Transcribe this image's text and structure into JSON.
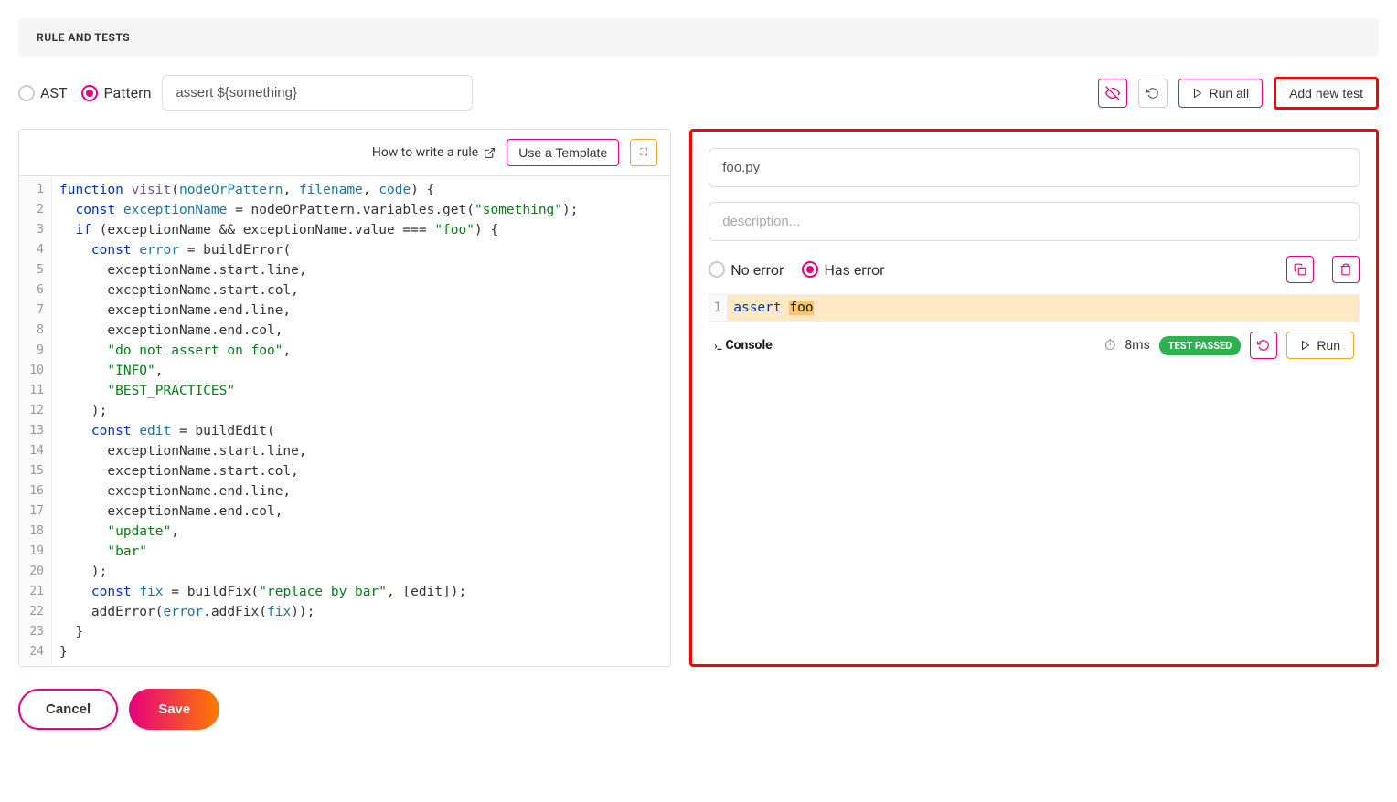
{
  "header": {
    "title": "RULE AND TESTS"
  },
  "mode": {
    "ast_label": "AST",
    "pattern_label": "Pattern",
    "pattern_value": "assert ${something}"
  },
  "toolbar": {
    "run_all_label": "Run all",
    "add_test_label": "Add new test"
  },
  "editor_toolbar": {
    "howto_label": "How to write a rule",
    "template_label": "Use a Template"
  },
  "code": {
    "lines": [
      [
        {
          "t": "kw",
          "s": "function"
        },
        {
          "t": "op",
          "s": " "
        },
        {
          "t": "fn",
          "s": "visit"
        },
        {
          "t": "op",
          "s": "("
        },
        {
          "t": "var",
          "s": "nodeOrPattern"
        },
        {
          "t": "op",
          "s": ", "
        },
        {
          "t": "var",
          "s": "filename"
        },
        {
          "t": "op",
          "s": ", "
        },
        {
          "t": "var",
          "s": "code"
        },
        {
          "t": "op",
          "s": ") {"
        }
      ],
      [
        {
          "t": "op",
          "s": "  "
        },
        {
          "t": "kw",
          "s": "const"
        },
        {
          "t": "op",
          "s": " "
        },
        {
          "t": "var",
          "s": "exceptionName"
        },
        {
          "t": "op",
          "s": " = nodeOrPattern.variables.get("
        },
        {
          "t": "str",
          "s": "\"something\""
        },
        {
          "t": "op",
          "s": ");"
        }
      ],
      [
        {
          "t": "op",
          "s": "  "
        },
        {
          "t": "kw",
          "s": "if"
        },
        {
          "t": "op",
          "s": " (exceptionName && exceptionName.value === "
        },
        {
          "t": "str",
          "s": "\"foo\""
        },
        {
          "t": "op",
          "s": ") {"
        }
      ],
      [
        {
          "t": "op",
          "s": "    "
        },
        {
          "t": "kw",
          "s": "const"
        },
        {
          "t": "op",
          "s": " "
        },
        {
          "t": "var",
          "s": "error"
        },
        {
          "t": "op",
          "s": " = buildError("
        }
      ],
      [
        {
          "t": "op",
          "s": "      exceptionName.start.line,"
        }
      ],
      [
        {
          "t": "op",
          "s": "      exceptionName.start.col,"
        }
      ],
      [
        {
          "t": "op",
          "s": "      exceptionName.end.line,"
        }
      ],
      [
        {
          "t": "op",
          "s": "      exceptionName.end.col,"
        }
      ],
      [
        {
          "t": "op",
          "s": "      "
        },
        {
          "t": "str",
          "s": "\"do not assert on foo\""
        },
        {
          "t": "op",
          "s": ","
        }
      ],
      [
        {
          "t": "op",
          "s": "      "
        },
        {
          "t": "str",
          "s": "\"INFO\""
        },
        {
          "t": "op",
          "s": ","
        }
      ],
      [
        {
          "t": "op",
          "s": "      "
        },
        {
          "t": "str",
          "s": "\"BEST_PRACTICES\""
        }
      ],
      [
        {
          "t": "op",
          "s": "    );"
        }
      ],
      [
        {
          "t": "op",
          "s": "    "
        },
        {
          "t": "kw",
          "s": "const"
        },
        {
          "t": "op",
          "s": " "
        },
        {
          "t": "var",
          "s": "edit"
        },
        {
          "t": "op",
          "s": " = buildEdit("
        }
      ],
      [
        {
          "t": "op",
          "s": "      exceptionName.start.line,"
        }
      ],
      [
        {
          "t": "op",
          "s": "      exceptionName.start.col,"
        }
      ],
      [
        {
          "t": "op",
          "s": "      exceptionName.end.line,"
        }
      ],
      [
        {
          "t": "op",
          "s": "      exceptionName.end.col,"
        }
      ],
      [
        {
          "t": "op",
          "s": "      "
        },
        {
          "t": "str",
          "s": "\"update\""
        },
        {
          "t": "op",
          "s": ","
        }
      ],
      [
        {
          "t": "op",
          "s": "      "
        },
        {
          "t": "str",
          "s": "\"bar\""
        }
      ],
      [
        {
          "t": "op",
          "s": "    );"
        }
      ],
      [
        {
          "t": "op",
          "s": "    "
        },
        {
          "t": "kw",
          "s": "const"
        },
        {
          "t": "op",
          "s": " "
        },
        {
          "t": "var",
          "s": "fix"
        },
        {
          "t": "op",
          "s": " = buildFix("
        },
        {
          "t": "str",
          "s": "\"replace by bar\""
        },
        {
          "t": "op",
          "s": ", [edit]);"
        }
      ],
      [
        {
          "t": "op",
          "s": "    addError("
        },
        {
          "t": "var",
          "s": "error"
        },
        {
          "t": "op",
          "s": ".addFix("
        },
        {
          "t": "var",
          "s": "fix"
        },
        {
          "t": "op",
          "s": "));"
        }
      ],
      [
        {
          "t": "op",
          "s": "  }"
        }
      ],
      [
        {
          "t": "op",
          "s": "}"
        }
      ]
    ]
  },
  "test": {
    "filename": "foo.py",
    "description_placeholder": "description...",
    "no_error_label": "No error",
    "has_error_label": "Has error",
    "code_line": {
      "kw": "assert",
      "val": "foo"
    },
    "console_label": "Console",
    "time": "8ms",
    "passed_label": "TEST PASSED",
    "run_label": "Run"
  },
  "footer": {
    "cancel_label": "Cancel",
    "save_label": "Save"
  }
}
